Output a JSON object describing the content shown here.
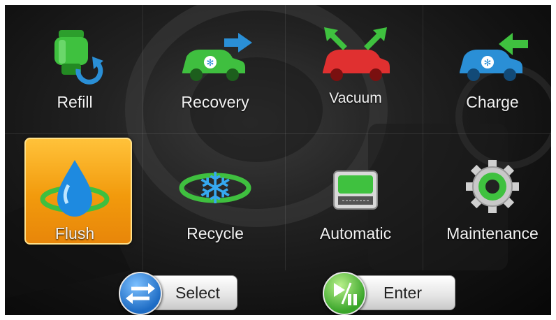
{
  "menu": {
    "items": [
      {
        "label": "Refill"
      },
      {
        "label": "Recovery"
      },
      {
        "label": "Vacuum"
      },
      {
        "label": "Charge"
      },
      {
        "label": "Flush",
        "selected": true
      },
      {
        "label": "Recycle"
      },
      {
        "label": "Automatic"
      },
      {
        "label": "Maintenance"
      }
    ]
  },
  "buttons": {
    "select": {
      "label": "Select",
      "icon": "swap-arrows-icon"
    },
    "enter": {
      "label": "Enter",
      "icon": "play-pause-icon"
    }
  },
  "colors": {
    "selected_bg": "#f29a0c",
    "green": "#39b54a",
    "blue": "#2a8fd6",
    "red": "#e03030"
  }
}
